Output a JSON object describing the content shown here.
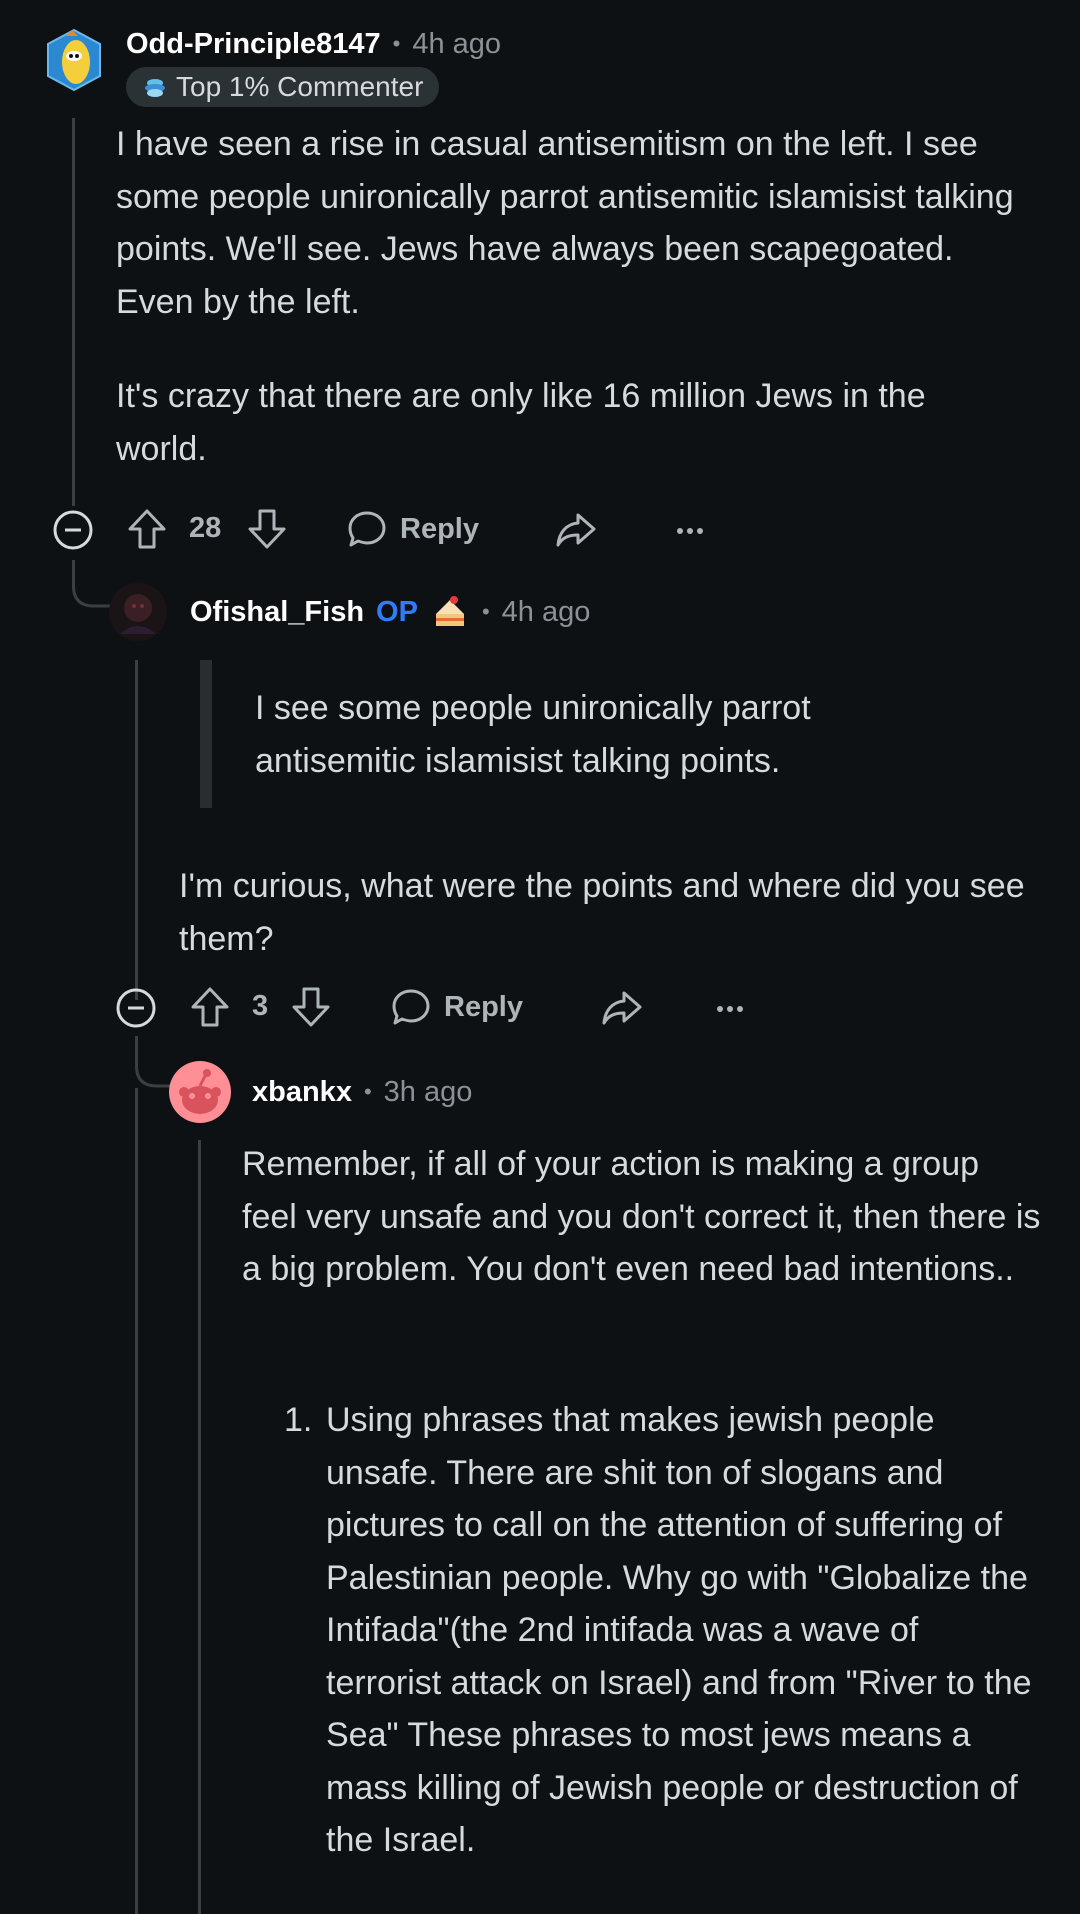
{
  "comments": [
    {
      "username": "Odd-Principle8147",
      "time": "4h ago",
      "badge": "Top 1% Commenter",
      "paragraphs": [
        "I have seen a rise in casual antisemitism on the left. I see some people unironically parrot antisemitic islamisist talking points. We'll see. Jews have always been scapegoated. Even by the left.",
        "It's crazy that there are only like 16 million Jews in the world."
      ],
      "votes": "28",
      "reply_label": "Reply"
    },
    {
      "username": "Ofishal_Fish",
      "op_label": "OP",
      "time": "4h ago",
      "quote": "I see some people unironically parrot antisemitic islamisist talking points.",
      "paragraphs": [
        "I'm curious, what were the points and where did you see them?"
      ],
      "votes": "3",
      "reply_label": "Reply"
    },
    {
      "username": "xbankx",
      "time": "3h ago",
      "paragraphs": [
        "Remember, if all of your action is making a group feel very unsafe and you don't correct it, then there is a big problem. You don't even need bad intentions.."
      ],
      "list_number": "1.",
      "list_item": "Using phrases that makes jewish people unsafe. There are shit ton of slogans and pictures to call on the attention of suffering of Palestinian people. Why go with \"Globalize the Intifada\"(the 2nd intifada was a wave of terrorist attack on Israel) and from \"River to the Sea\" These phrases to most jews means a mass killing of Jewish people or destruction of the Israel."
    }
  ],
  "separator": "•",
  "colors": {
    "background": "#0e1113",
    "text": "#d7dadc",
    "muted": "#8a9297",
    "op": "#2f7dff",
    "thread_line": "#3a3f42"
  },
  "icons": {
    "collapse": "minus-circle-icon",
    "upvote": "arrow-up-icon",
    "downvote": "arrow-down-icon",
    "reply": "speech-bubble-icon",
    "share": "share-arrow-icon",
    "more": "ellipsis-icon",
    "badge": "top-commenter-icon",
    "cake": "cake-day-icon"
  }
}
